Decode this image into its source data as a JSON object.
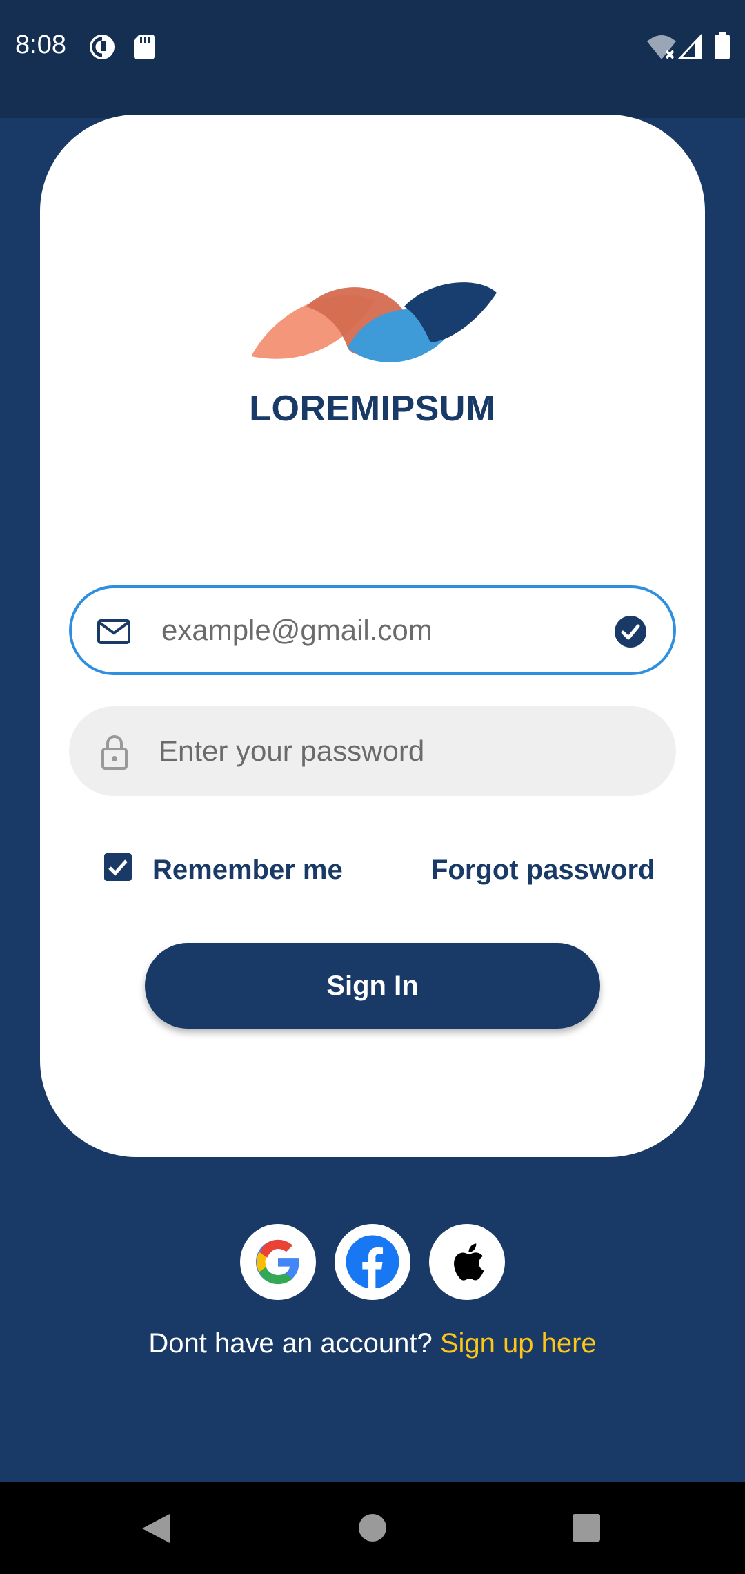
{
  "status_bar": {
    "time": "8:08",
    "left_icons": [
      "pocket-casts-icon",
      "sd-card-icon"
    ],
    "right_icons": [
      "wifi-off-icon",
      "signal-icon",
      "battery-icon"
    ]
  },
  "brand": {
    "name": "LOREMIPSUM",
    "logo_colors": [
      "#f4967a",
      "#d46c50",
      "#3f9ad8",
      "#173e6e"
    ]
  },
  "login": {
    "email": {
      "value": "",
      "placeholder": "example@gmail.com",
      "valid": true
    },
    "password": {
      "value": "",
      "placeholder": "Enter your password"
    },
    "remember_me": {
      "label": "Remember me",
      "checked": true
    },
    "forgot_password_label": "Forgot password",
    "sign_in_label": "Sign In"
  },
  "social_logins": [
    "google-icon",
    "facebook-icon",
    "apple-icon"
  ],
  "footer": {
    "prompt": "Dont have an account? ",
    "signup_label": "Sign up here"
  },
  "colors": {
    "primary": "#193a66",
    "accent": "#ffc61a",
    "focus": "#2e8ee0"
  },
  "nav_bar": [
    "back-icon",
    "home-icon",
    "recents-icon"
  ]
}
